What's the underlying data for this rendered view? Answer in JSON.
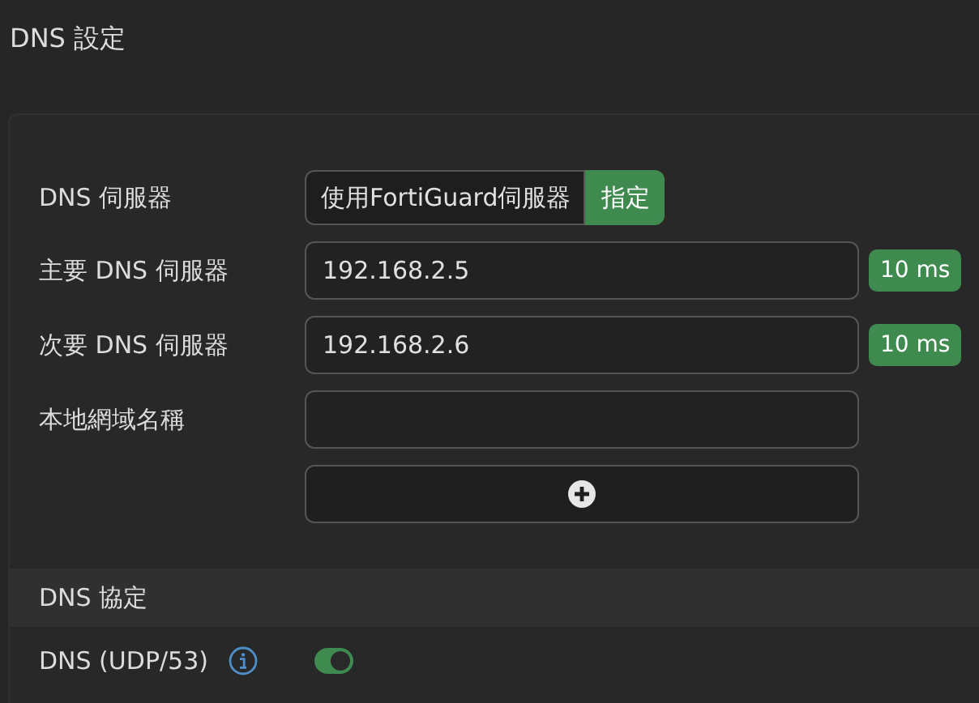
{
  "page_title": "DNS 設定",
  "dns_server": {
    "label": "DNS 伺服器",
    "options": [
      {
        "label": "使用FortiGuard伺服器",
        "selected": false
      },
      {
        "label": "指定",
        "selected": true
      }
    ]
  },
  "servers": [
    {
      "label": "主要 DNS 伺服器",
      "value": "192.168.2.5",
      "latency": "10 ms"
    },
    {
      "label": "次要 DNS 伺服器",
      "value": "192.168.2.6",
      "latency": "10 ms"
    }
  ],
  "local_domain": {
    "label": "本地網域名稱"
  },
  "protocols_section": {
    "title": "DNS 協定",
    "items": [
      {
        "label": "DNS (UDP/53)",
        "on": true
      }
    ]
  }
}
